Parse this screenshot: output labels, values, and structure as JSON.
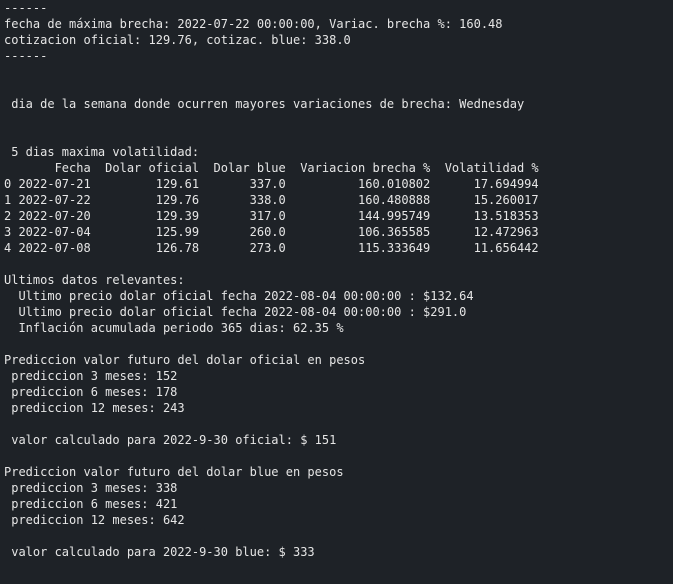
{
  "output": {
    "lines": [
      "------",
      "fecha de máxima brecha: 2022-07-22 00:00:00, Variac. brecha %: 160.48",
      "cotizacion oficial: 129.76, cotizac. blue: 338.0",
      "------",
      "",
      "",
      " dia de la semana donde ocurren mayores variaciones de brecha: Wednesday",
      "",
      "",
      " 5 dias maxima volatilidad:",
      "       Fecha  Dolar oficial  Dolar blue  Variacion brecha %  Volatilidad %",
      "0 2022-07-21         129.61       337.0          160.010802      17.694994",
      "1 2022-07-22         129.76       338.0          160.480888      15.260017",
      "2 2022-07-20         129.39       317.0          144.995749      13.518353",
      "3 2022-07-04         125.99       260.0          106.365585      12.472963",
      "4 2022-07-08         126.78       273.0          115.333649      11.656442",
      "",
      "Ultimos datos relevantes:",
      "  Ultimo precio dolar oficial fecha 2022-08-04 00:00:00 : $132.64",
      "  Ultimo precio dolar oficial fecha 2022-08-04 00:00:00 : $291.0",
      "  Inflación acumulada periodo 365 dias: 62.35 %",
      "",
      "Prediccion valor futuro del dolar oficial en pesos",
      " prediccion 3 meses: 152",
      " prediccion 6 meses: 178",
      " prediccion 12 meses: 243",
      "",
      " valor calculado para 2022-9-30 oficial: $ 151",
      "",
      "Prediccion valor futuro del dolar blue en pesos",
      " prediccion 3 meses: 338",
      " prediccion 6 meses: 421",
      " prediccion 12 meses: 642",
      "",
      " valor calculado para 2022-9-30 blue: $ 333"
    ]
  }
}
